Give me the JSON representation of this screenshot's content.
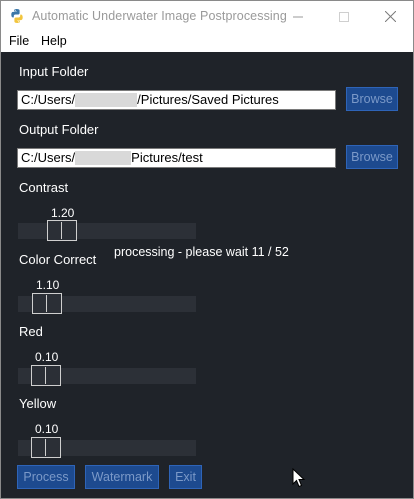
{
  "window": {
    "title": "Automatic Underwater Image Postprocessing"
  },
  "menu": {
    "items": [
      "File",
      "Help"
    ]
  },
  "input_folder": {
    "label": "Input Folder",
    "value_prefix": "C:/Users/",
    "value_suffix": "/Pictures/Saved Pictures",
    "browse_label": "Browse"
  },
  "output_folder": {
    "label": "Output Folder",
    "value_prefix": "C:/Users/",
    "value_suffix": "Pictures/test",
    "browse_label": "Browse"
  },
  "sliders": {
    "contrast": {
      "label": "Contrast",
      "value": "1.20"
    },
    "color_correct": {
      "label": "Color Correct",
      "value": "1.10"
    },
    "red": {
      "label": "Red",
      "value": "0.10"
    },
    "yellow": {
      "label": "Yellow",
      "value": "0.10"
    }
  },
  "status": {
    "text": "processing - please wait  11 / 52"
  },
  "actions": {
    "process_label": "Process",
    "watermark_label": "Watermark",
    "exit_label": "Exit"
  },
  "colors": {
    "background": "#1f2329",
    "button": "#1d4a8f",
    "button_text": "#7b99c8"
  }
}
